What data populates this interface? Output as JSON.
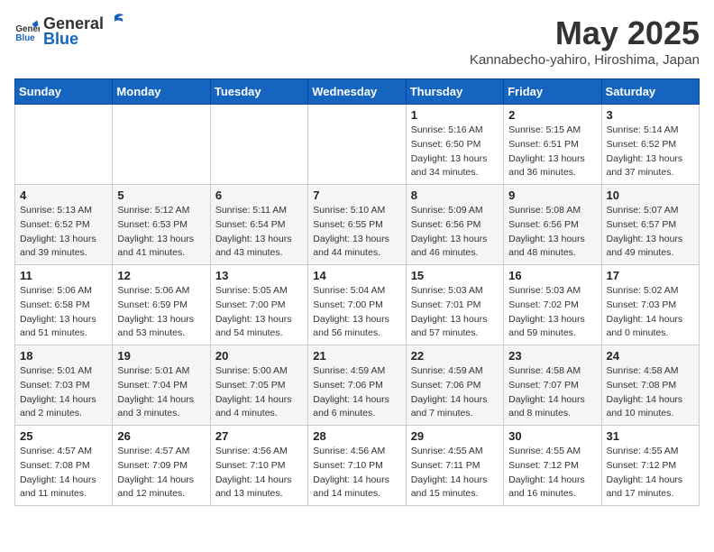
{
  "header": {
    "logo_general": "General",
    "logo_blue": "Blue",
    "title": "May 2025",
    "subtitle": "Kannabecho-yahiro, Hiroshima, Japan"
  },
  "days_of_week": [
    "Sunday",
    "Monday",
    "Tuesday",
    "Wednesday",
    "Thursday",
    "Friday",
    "Saturday"
  ],
  "weeks": [
    [
      {
        "day": "",
        "info": ""
      },
      {
        "day": "",
        "info": ""
      },
      {
        "day": "",
        "info": ""
      },
      {
        "day": "",
        "info": ""
      },
      {
        "day": "1",
        "info": "Sunrise: 5:16 AM\nSunset: 6:50 PM\nDaylight: 13 hours\nand 34 minutes."
      },
      {
        "day": "2",
        "info": "Sunrise: 5:15 AM\nSunset: 6:51 PM\nDaylight: 13 hours\nand 36 minutes."
      },
      {
        "day": "3",
        "info": "Sunrise: 5:14 AM\nSunset: 6:52 PM\nDaylight: 13 hours\nand 37 minutes."
      }
    ],
    [
      {
        "day": "4",
        "info": "Sunrise: 5:13 AM\nSunset: 6:52 PM\nDaylight: 13 hours\nand 39 minutes."
      },
      {
        "day": "5",
        "info": "Sunrise: 5:12 AM\nSunset: 6:53 PM\nDaylight: 13 hours\nand 41 minutes."
      },
      {
        "day": "6",
        "info": "Sunrise: 5:11 AM\nSunset: 6:54 PM\nDaylight: 13 hours\nand 43 minutes."
      },
      {
        "day": "7",
        "info": "Sunrise: 5:10 AM\nSunset: 6:55 PM\nDaylight: 13 hours\nand 44 minutes."
      },
      {
        "day": "8",
        "info": "Sunrise: 5:09 AM\nSunset: 6:56 PM\nDaylight: 13 hours\nand 46 minutes."
      },
      {
        "day": "9",
        "info": "Sunrise: 5:08 AM\nSunset: 6:56 PM\nDaylight: 13 hours\nand 48 minutes."
      },
      {
        "day": "10",
        "info": "Sunrise: 5:07 AM\nSunset: 6:57 PM\nDaylight: 13 hours\nand 49 minutes."
      }
    ],
    [
      {
        "day": "11",
        "info": "Sunrise: 5:06 AM\nSunset: 6:58 PM\nDaylight: 13 hours\nand 51 minutes."
      },
      {
        "day": "12",
        "info": "Sunrise: 5:06 AM\nSunset: 6:59 PM\nDaylight: 13 hours\nand 53 minutes."
      },
      {
        "day": "13",
        "info": "Sunrise: 5:05 AM\nSunset: 7:00 PM\nDaylight: 13 hours\nand 54 minutes."
      },
      {
        "day": "14",
        "info": "Sunrise: 5:04 AM\nSunset: 7:00 PM\nDaylight: 13 hours\nand 56 minutes."
      },
      {
        "day": "15",
        "info": "Sunrise: 5:03 AM\nSunset: 7:01 PM\nDaylight: 13 hours\nand 57 minutes."
      },
      {
        "day": "16",
        "info": "Sunrise: 5:03 AM\nSunset: 7:02 PM\nDaylight: 13 hours\nand 59 minutes."
      },
      {
        "day": "17",
        "info": "Sunrise: 5:02 AM\nSunset: 7:03 PM\nDaylight: 14 hours\nand 0 minutes."
      }
    ],
    [
      {
        "day": "18",
        "info": "Sunrise: 5:01 AM\nSunset: 7:03 PM\nDaylight: 14 hours\nand 2 minutes."
      },
      {
        "day": "19",
        "info": "Sunrise: 5:01 AM\nSunset: 7:04 PM\nDaylight: 14 hours\nand 3 minutes."
      },
      {
        "day": "20",
        "info": "Sunrise: 5:00 AM\nSunset: 7:05 PM\nDaylight: 14 hours\nand 4 minutes."
      },
      {
        "day": "21",
        "info": "Sunrise: 4:59 AM\nSunset: 7:06 PM\nDaylight: 14 hours\nand 6 minutes."
      },
      {
        "day": "22",
        "info": "Sunrise: 4:59 AM\nSunset: 7:06 PM\nDaylight: 14 hours\nand 7 minutes."
      },
      {
        "day": "23",
        "info": "Sunrise: 4:58 AM\nSunset: 7:07 PM\nDaylight: 14 hours\nand 8 minutes."
      },
      {
        "day": "24",
        "info": "Sunrise: 4:58 AM\nSunset: 7:08 PM\nDaylight: 14 hours\nand 10 minutes."
      }
    ],
    [
      {
        "day": "25",
        "info": "Sunrise: 4:57 AM\nSunset: 7:08 PM\nDaylight: 14 hours\nand 11 minutes."
      },
      {
        "day": "26",
        "info": "Sunrise: 4:57 AM\nSunset: 7:09 PM\nDaylight: 14 hours\nand 12 minutes."
      },
      {
        "day": "27",
        "info": "Sunrise: 4:56 AM\nSunset: 7:10 PM\nDaylight: 14 hours\nand 13 minutes."
      },
      {
        "day": "28",
        "info": "Sunrise: 4:56 AM\nSunset: 7:10 PM\nDaylight: 14 hours\nand 14 minutes."
      },
      {
        "day": "29",
        "info": "Sunrise: 4:55 AM\nSunset: 7:11 PM\nDaylight: 14 hours\nand 15 minutes."
      },
      {
        "day": "30",
        "info": "Sunrise: 4:55 AM\nSunset: 7:12 PM\nDaylight: 14 hours\nand 16 minutes."
      },
      {
        "day": "31",
        "info": "Sunrise: 4:55 AM\nSunset: 7:12 PM\nDaylight: 14 hours\nand 17 minutes."
      }
    ]
  ]
}
